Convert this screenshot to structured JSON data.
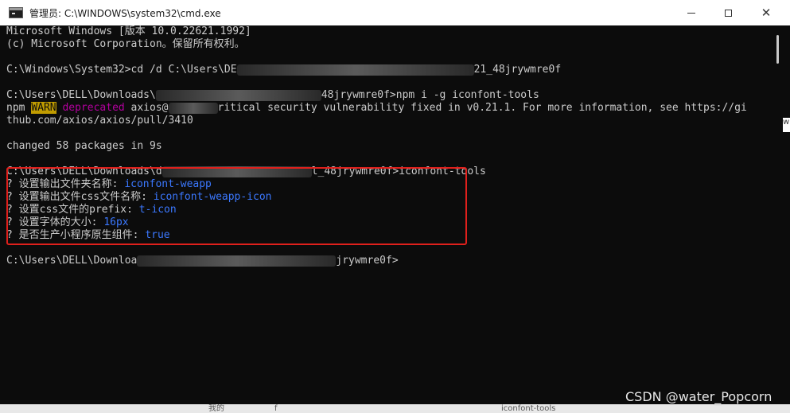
{
  "window": {
    "title": "管理员: C:\\WINDOWS\\system32\\cmd.exe",
    "controls": [
      "minimize",
      "maximize",
      "close"
    ]
  },
  "terminal": {
    "lines": [
      {
        "id": "l1",
        "text": "Microsoft Windows [版本 10.0.22621.1992]"
      },
      {
        "id": "l2",
        "text": "(c) Microsoft Corporation。保留所有权利。"
      },
      {
        "id": "l3a",
        "text": "C:\\Windows\\System32>cd /d C:\\Users\\DE"
      },
      {
        "id": "l3b",
        "text": "21_48jrywmre0f"
      },
      {
        "id": "l4a",
        "text": "C:\\Users\\DELL\\Downloads\\"
      },
      {
        "id": "l4b",
        "text": "48jrywmre0f>npm i -g iconfont-tools"
      },
      {
        "id": "l5a",
        "text": "npm "
      },
      {
        "id": "l5warn",
        "text": "WARN"
      },
      {
        "id": "l5dep",
        "text": " deprecated"
      },
      {
        "id": "l5b",
        "text": " axios@"
      },
      {
        "id": "l5c",
        "text": "ritical security vulnerability fixed in v0.21.1. For more information, see https://gi"
      },
      {
        "id": "l6",
        "text": "thub.com/axios/axios/pull/3410"
      },
      {
        "id": "l7",
        "text": "changed 58 packages in 9s"
      },
      {
        "id": "l8a",
        "text": "C:\\Users\\DELL\\Downloads\\d"
      },
      {
        "id": "l8b",
        "text": "l_48jrywmre0f>iconfont-tools"
      },
      {
        "id": "q1label",
        "text": "? 设置输出文件夹名称: "
      },
      {
        "id": "q1val",
        "text": "iconfont-weapp"
      },
      {
        "id": "q2label",
        "text": "? 设置输出文件css文件名称: "
      },
      {
        "id": "q2val",
        "text": "iconfont-weapp-icon"
      },
      {
        "id": "q3label",
        "text": "? 设置css文件的prefix: "
      },
      {
        "id": "q3val",
        "text": "t-icon"
      },
      {
        "id": "q4label",
        "text": "? 设置字体的大小: "
      },
      {
        "id": "q4val",
        "text": "16px"
      },
      {
        "id": "q5label",
        "text": "? 是否生产小程序原生组件: "
      },
      {
        "id": "q5val",
        "text": "true"
      },
      {
        "id": "l10a",
        "text": "C:\\Users\\DELL\\Downloa"
      },
      {
        "id": "l10b",
        "text": "jrywmre0f>"
      }
    ]
  },
  "colors": {
    "background": "#0c0c0c",
    "text": "#cccccc",
    "warn_bg": "#c19c00",
    "deprecated": "#b4009e",
    "answer": "#3b78ff",
    "highlight_border": "#e0201c"
  },
  "side_peek": "w",
  "bottom": {
    "item1": "我的",
    "item2": "f",
    "item3": "iconfont-tools"
  },
  "watermark": "CSDN @water_Popcorn"
}
